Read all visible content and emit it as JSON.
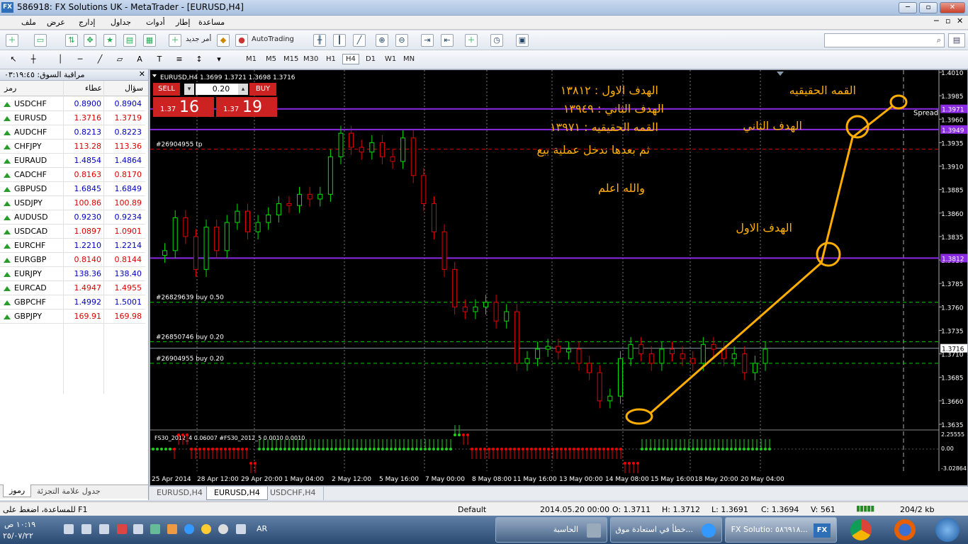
{
  "window": {
    "title": "586918: FX Solutions UK - MetaTrader - [EURUSD,H4]",
    "logo": "FX"
  },
  "menu": [
    "ملف",
    "عرض",
    "إدارج",
    "جداول",
    "أدوات",
    "إطار",
    "مساعدة"
  ],
  "toolbar": {
    "new_order": "أمر جديد",
    "autotrading": "AutoTrading"
  },
  "timeframes": [
    "M1",
    "M5",
    "M15",
    "M30",
    "H1",
    "H4",
    "D1",
    "W1",
    "MN"
  ],
  "active_timeframe": "H4",
  "market_watch": {
    "title": "مراقبة السوق: ٠٣:١٩:٤٥",
    "col_symbol": "رمز",
    "col_bid": "عطاء",
    "col_ask": "سؤال",
    "rows": [
      {
        "symbol": "USDCHF",
        "bid": "0.8900",
        "ask": "0.8904",
        "dir": "up"
      },
      {
        "symbol": "EURUSD",
        "bid": "1.3716",
        "ask": "1.3719",
        "dir": "up"
      },
      {
        "symbol": "AUDCHF",
        "bid": "0.8213",
        "ask": "0.8223",
        "dir": "up"
      },
      {
        "symbol": "CHFJPY",
        "bid": "113.28",
        "ask": "113.36",
        "dir": "up"
      },
      {
        "symbol": "EURAUD",
        "bid": "1.4854",
        "ask": "1.4864",
        "dir": "up"
      },
      {
        "symbol": "CADCHF",
        "bid": "0.8163",
        "ask": "0.8170",
        "dir": "up"
      },
      {
        "symbol": "GBPUSD",
        "bid": "1.6845",
        "ask": "1.6849",
        "dir": "up"
      },
      {
        "symbol": "USDJPY",
        "bid": "100.86",
        "ask": "100.89",
        "dir": "up"
      },
      {
        "symbol": "AUDUSD",
        "bid": "0.9230",
        "ask": "0.9234",
        "dir": "up"
      },
      {
        "symbol": "USDCAD",
        "bid": "1.0897",
        "ask": "1.0901",
        "dir": "up"
      },
      {
        "symbol": "EURCHF",
        "bid": "1.2210",
        "ask": "1.2214",
        "dir": "up"
      },
      {
        "symbol": "EURGBP",
        "bid": "0.8140",
        "ask": "0.8144",
        "dir": "up"
      },
      {
        "symbol": "EURJPY",
        "bid": "138.36",
        "ask": "138.40",
        "dir": "up"
      },
      {
        "symbol": "EURCAD",
        "bid": "1.4947",
        "ask": "1.4955",
        "dir": "up"
      },
      {
        "symbol": "GBPCHF",
        "bid": "1.4992",
        "ask": "1.5001",
        "dir": "up"
      },
      {
        "symbol": "GBPJPY",
        "bid": "169.91",
        "ask": "169.98",
        "dir": "up"
      }
    ],
    "tabs": [
      "رموز",
      "جدول علامة التجزئة"
    ]
  },
  "chart": {
    "header": "EURUSD,H4  1.3699 1.3721 1.3698 1.3716",
    "sell_label": "SELL",
    "buy_label": "BUY",
    "lot": "0.20",
    "sell_small": "1.37",
    "sell_big": "16",
    "buy_small": "1.37",
    "buy_big": "19",
    "price_ticks": [
      "1.4010",
      "1.3985",
      "1.3960",
      "1.3935",
      "1.3910",
      "1.3885",
      "1.3860",
      "1.3835",
      "1.3810",
      "1.3785",
      "1.3760",
      "1.3735",
      "1.3710",
      "1.3685",
      "1.3660",
      "1.3635"
    ],
    "tags": {
      "t1": "1.3971",
      "t2": "1.3949",
      "t3": "1.3812",
      "cur": "1.3716"
    },
    "order_labels": [
      "#26904955 tp",
      "#26829639 buy 0.50",
      "#26850746 buy 0.20",
      "#26904955 buy 0.20"
    ],
    "spread": "Spread",
    "notes": [
      "الهدف الاول : ١٣٨١٢",
      "الهدف الثاني : ١٣٩٤٩",
      "القمه الحقيقيه : ١٣٩٧١",
      "ثم  بعدها ندخل عملية بيع",
      "والله اعلم"
    ],
    "lbl_top": "القمه  الحقيقيه",
    "lbl_t2": "الهدف الثاني",
    "lbl_t1": "الهدف  الاول",
    "ind_label": "FS30_2012_4 0.06007  #FS30_2012_5 0.0010 0.0010",
    "ind_ticks": [
      "2.25555",
      "0.00",
      "-3.02864"
    ],
    "dates": [
      "25 Apr 2014",
      "28 Apr 12:00",
      "29 Apr 20:00",
      "1 May 04:00",
      "2 May 12:00",
      "5 May 16:00",
      "7 May 00:00",
      "8 May 08:00",
      "11 May 16:00",
      "13 May 00:00",
      "14 May 08:00",
      "15 May 16:00",
      "18 May 20:00",
      "20 May 04:00"
    ]
  },
  "chart_tabs": [
    "EURUSD,H4",
    "EURUSD,H4",
    "USDCHF,H4"
  ],
  "status": {
    "help": "للمساعدة، اضغط على F1",
    "profile": "Default",
    "datetime": "2014.05.20 00:00",
    "o": "O: 1.3711",
    "h": "H: 1.3712",
    "l": "L: 1.3691",
    "c": "C: 1.3694",
    "v": "V: 561",
    "traffic": "204/2 kb"
  },
  "taskbar": {
    "task1": "الحاسبة",
    "task2": "خطأ في استعادة موق...",
    "task3": "FX Solutio: ٥٨٦٩١٨...",
    "lang": "AR",
    "clock_time": "١٠:١٩ ص",
    "clock_date": "٢٥/٠٧/٢٢"
  },
  "colors": {
    "bull": "#00e000",
    "bear": "#e00000",
    "target": "#8a2be2",
    "annot": "#ffae00",
    "grid": "#777"
  }
}
